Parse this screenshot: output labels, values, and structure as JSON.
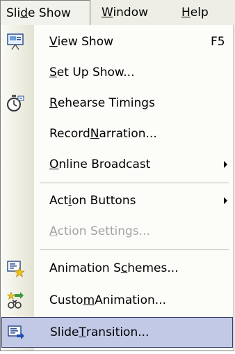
{
  "menubar": {
    "active_menu": "Slide Show",
    "items": [
      {
        "label": "Slide Show",
        "mnemonic_before": "Sli",
        "mnemonic": "d",
        "mnemonic_after": "e Show"
      },
      {
        "label": "Window",
        "mnemonic_before": "",
        "mnemonic": "W",
        "mnemonic_after": "indow"
      },
      {
        "label": "Help",
        "mnemonic_before": "",
        "mnemonic": "H",
        "mnemonic_after": "elp"
      }
    ]
  },
  "menu": {
    "items": [
      {
        "label": "View Show",
        "pre": "",
        "key": "V",
        "post": "iew Show",
        "shortcut": "F5",
        "icon": "presentation-screen-icon",
        "enabled": true
      },
      {
        "label": "Set Up Show...",
        "pre": "",
        "key": "S",
        "post": "et Up Show...",
        "enabled": true
      },
      {
        "label": "Rehearse Timings",
        "pre": "",
        "key": "R",
        "post": "ehearse Timings",
        "icon": "stopwatch-icon",
        "enabled": true
      },
      {
        "label": "Record Narration...",
        "pre": "Record ",
        "key": "N",
        "post": "arration...",
        "enabled": true
      },
      {
        "label": "Online Broadcast",
        "pre": "",
        "key": "O",
        "post": "nline Broadcast",
        "submenu": true,
        "enabled": true
      },
      {
        "label": "Action Buttons",
        "pre": "Act",
        "key": "i",
        "post": "on Buttons",
        "submenu": true,
        "enabled": true
      },
      {
        "label": "Action Settings...",
        "pre": "",
        "key": "A",
        "post": "ction Settings...",
        "enabled": false
      },
      {
        "label": "Animation Schemes...",
        "pre": "Animation S",
        "key": "c",
        "post": "hemes...",
        "icon": "animation-schemes-icon",
        "enabled": true
      },
      {
        "label": "Custom Animation...",
        "pre": "Custo",
        "key": "m",
        "post": " Animation...",
        "icon": "custom-animation-icon",
        "enabled": true
      },
      {
        "label": "Slide Transition...",
        "pre": "Slide ",
        "key": "T",
        "post": "ransition...",
        "icon": "slide-transition-icon",
        "enabled": true,
        "highlighted": true
      }
    ]
  },
  "colors": {
    "menu_background": "#fcfcf9",
    "menubar_background": "#eeeee6",
    "highlight_fill": "#c2c9e6",
    "highlight_border": "#39406a",
    "disabled_text": "#a3a3a3"
  }
}
